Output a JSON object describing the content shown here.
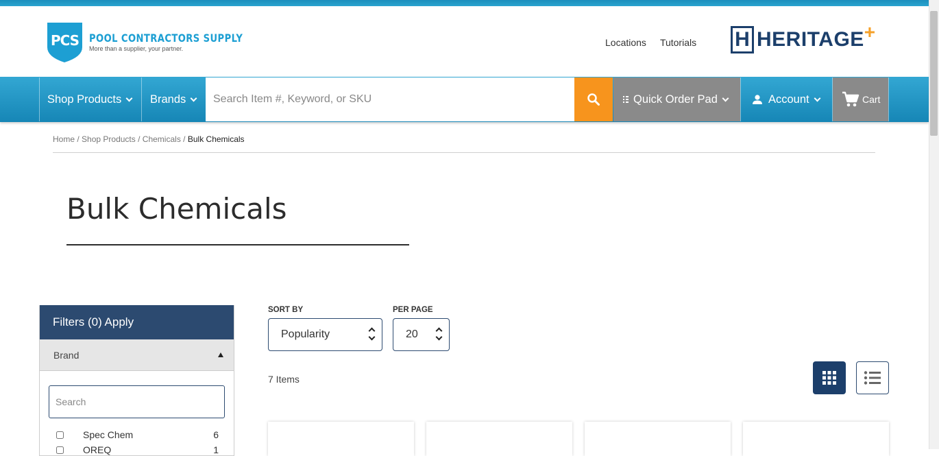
{
  "header": {
    "logo_name": "POOL CONTRACTORS SUPPLY",
    "logo_mark": "PCS",
    "logo_tagline": "More than a supplier, your partner.",
    "links": [
      "Locations",
      "Tutorials"
    ],
    "heritage_logo": "HERITAGE",
    "heritage_mark": "H",
    "heritage_plus": "+"
  },
  "nav": {
    "shop_products": "Shop Products",
    "brands": "Brands",
    "search_placeholder": "Search Item #, Keyword, or SKU",
    "quick_order_pad": "Quick Order Pad",
    "account": "Account",
    "cart": "Cart"
  },
  "breadcrumb": {
    "items": [
      "Home",
      "Shop Products",
      "Chemicals"
    ],
    "current": "Bulk Chemicals",
    "separator": "/"
  },
  "page": {
    "title": "Bulk Chemicals"
  },
  "filters": {
    "header": "Filters (0) Apply",
    "brand_header": "Brand",
    "search_placeholder": "Search",
    "brands": [
      {
        "name": "Spec Chem",
        "count": "6"
      },
      {
        "name": "OREQ",
        "count": "1"
      }
    ]
  },
  "results": {
    "sort_label": "SORT BY",
    "sort_value": "Popularity",
    "per_page_label": "PER PAGE",
    "per_page_value": "20",
    "count_text": "7 Items"
  },
  "icons": {
    "search": "search-icon",
    "cart": "cart-icon",
    "account": "user-icon",
    "quick_order": "list-small-icon",
    "grid_view": "grid-icon",
    "list_view": "list-icon"
  },
  "colors": {
    "nav_blue": "#1f95c4",
    "search_orange": "#f7941d",
    "nav_gray": "#8a8a8a",
    "navy": "#2c4a70",
    "brand_blue": "#1d9fd3"
  }
}
